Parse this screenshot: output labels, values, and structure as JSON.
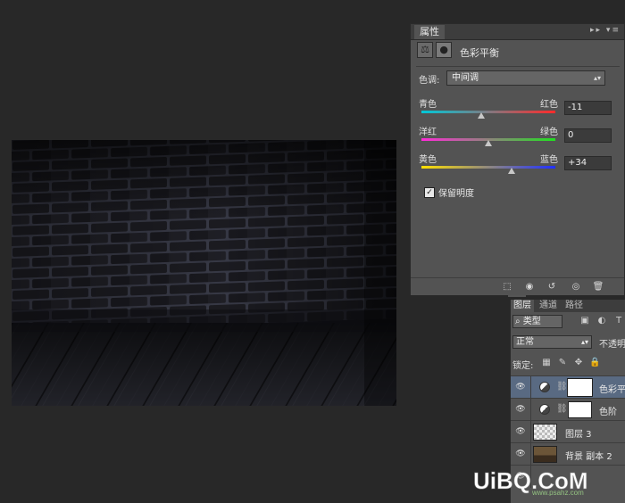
{
  "properties_panel": {
    "tab_label": "属性",
    "adjustment_title": "色彩平衡",
    "tone": {
      "label": "色调:",
      "value": "中间调"
    },
    "sliders": [
      {
        "left": "青色",
        "right": "红色",
        "value": "-11",
        "level": -11
      },
      {
        "left": "洋红",
        "right": "绿色",
        "value": "0",
        "level": 0
      },
      {
        "left": "黄色",
        "right": "蓝色",
        "value": "+34",
        "level": 34
      }
    ],
    "preserve_luminosity": {
      "label": "保留明度",
      "checked": true
    }
  },
  "layers_panel": {
    "tabs": [
      "图层",
      "通道",
      "路径"
    ],
    "filter_value": "类型",
    "blend_mode": "正常",
    "opacity_label": "不透明",
    "lock_label": "锁定:",
    "layers": [
      {
        "name": "色彩平",
        "type": "adjustment",
        "selected": true
      },
      {
        "name": "色阶",
        "type": "adjustment",
        "selected": false
      },
      {
        "name": "图层 3",
        "type": "pixel",
        "selected": false
      },
      {
        "name": "背景 副本 2",
        "type": "pixel",
        "selected": false
      }
    ]
  },
  "watermark": {
    "text": "UiBQ.CoM",
    "subtext": "www.psahz.com"
  },
  "colors": {
    "app_background": "#282828",
    "panel": "#535353",
    "selected_layer": "#596a82",
    "watermark": "#ffffff"
  }
}
